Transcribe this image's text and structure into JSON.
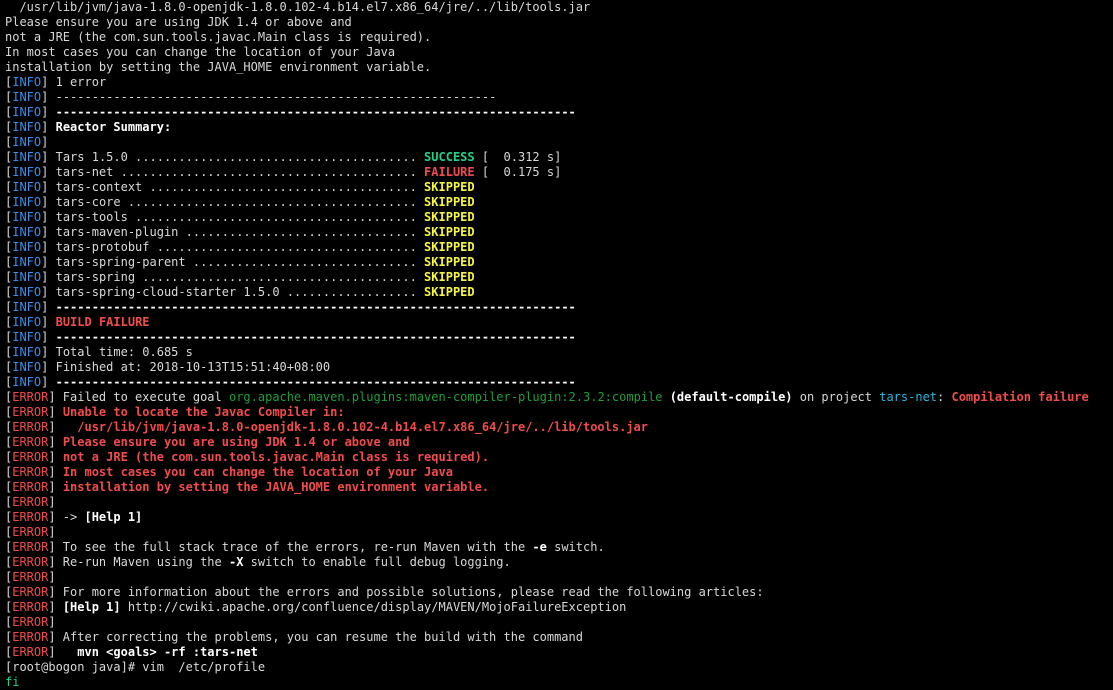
{
  "colors": {
    "background": "#000000",
    "default_text": "#d8d8d8",
    "info_tag": "#3b8eea",
    "error_tag": "#f14c4c",
    "success": "#23d18b",
    "skipped": "#f5f543",
    "plugin": "#1e9e3c",
    "project": "#29b8db"
  },
  "lines": [
    [
      {
        "t": "  /usr/lib/jvm/java-1.8.0-openjdk-1.8.0.102-4.b14.el7.x86_64/jre/../lib/tools.jar",
        "c": "default"
      }
    ],
    [
      {
        "t": "Please ensure you are using JDK 1.4 or above and",
        "c": "default"
      }
    ],
    [
      {
        "t": "not a JRE (the com.sun.tools.javac.Main class is required).",
        "c": "default"
      }
    ],
    [
      {
        "t": "In most cases you can change the location of your Java",
        "c": "default"
      }
    ],
    [
      {
        "t": "installation by setting the JAVA_HOME environment variable.",
        "c": "default"
      }
    ],
    [
      {
        "t": "[",
        "c": "default"
      },
      {
        "t": "INFO",
        "c": "blue"
      },
      {
        "t": "] 1 error",
        "c": "default"
      }
    ],
    [
      {
        "t": "[",
        "c": "default"
      },
      {
        "t": "INFO",
        "c": "blue"
      },
      {
        "t": "] -------------------------------------------------------------",
        "c": "default"
      }
    ],
    [
      {
        "t": "[",
        "c": "default"
      },
      {
        "t": "INFO",
        "c": "blue"
      },
      {
        "t": "] ",
        "c": "default"
      },
      {
        "t": "------------------------------------------------------------------------",
        "c": "white",
        "b": true
      }
    ],
    [
      {
        "t": "[",
        "c": "default"
      },
      {
        "t": "INFO",
        "c": "blue"
      },
      {
        "t": "] ",
        "c": "default"
      },
      {
        "t": "Reactor Summary:",
        "c": "white",
        "b": true
      }
    ],
    [
      {
        "t": "[",
        "c": "default"
      },
      {
        "t": "INFO",
        "c": "blue"
      },
      {
        "t": "]",
        "c": "default"
      }
    ],
    [
      {
        "t": "[",
        "c": "default"
      },
      {
        "t": "INFO",
        "c": "blue"
      },
      {
        "t": "] Tars 1.5.0 ....................................... ",
        "c": "default"
      },
      {
        "t": "SUCCESS",
        "c": "green",
        "b": true
      },
      {
        "t": " [  0.312 s]",
        "c": "default"
      }
    ],
    [
      {
        "t": "[",
        "c": "default"
      },
      {
        "t": "INFO",
        "c": "blue"
      },
      {
        "t": "] tars-net ......................................... ",
        "c": "default"
      },
      {
        "t": "FAILURE",
        "c": "red",
        "b": true
      },
      {
        "t": " [  0.175 s]",
        "c": "default"
      }
    ],
    [
      {
        "t": "[",
        "c": "default"
      },
      {
        "t": "INFO",
        "c": "blue"
      },
      {
        "t": "] tars-context ..................................... ",
        "c": "default"
      },
      {
        "t": "SKIPPED",
        "c": "yellow",
        "b": true
      }
    ],
    [
      {
        "t": "[",
        "c": "default"
      },
      {
        "t": "INFO",
        "c": "blue"
      },
      {
        "t": "] tars-core ........................................ ",
        "c": "default"
      },
      {
        "t": "SKIPPED",
        "c": "yellow",
        "b": true
      }
    ],
    [
      {
        "t": "[",
        "c": "default"
      },
      {
        "t": "INFO",
        "c": "blue"
      },
      {
        "t": "] tars-tools ....................................... ",
        "c": "default"
      },
      {
        "t": "SKIPPED",
        "c": "yellow",
        "b": true
      }
    ],
    [
      {
        "t": "[",
        "c": "default"
      },
      {
        "t": "INFO",
        "c": "blue"
      },
      {
        "t": "] tars-maven-plugin ................................ ",
        "c": "default"
      },
      {
        "t": "SKIPPED",
        "c": "yellow",
        "b": true
      }
    ],
    [
      {
        "t": "[",
        "c": "default"
      },
      {
        "t": "INFO",
        "c": "blue"
      },
      {
        "t": "] tars-protobuf .................................... ",
        "c": "default"
      },
      {
        "t": "SKIPPED",
        "c": "yellow",
        "b": true
      }
    ],
    [
      {
        "t": "[",
        "c": "default"
      },
      {
        "t": "INFO",
        "c": "blue"
      },
      {
        "t": "] tars-spring-parent ............................... ",
        "c": "default"
      },
      {
        "t": "SKIPPED",
        "c": "yellow",
        "b": true
      }
    ],
    [
      {
        "t": "[",
        "c": "default"
      },
      {
        "t": "INFO",
        "c": "blue"
      },
      {
        "t": "] tars-spring ...................................... ",
        "c": "default"
      },
      {
        "t": "SKIPPED",
        "c": "yellow",
        "b": true
      }
    ],
    [
      {
        "t": "[",
        "c": "default"
      },
      {
        "t": "INFO",
        "c": "blue"
      },
      {
        "t": "] tars-spring-cloud-starter 1.5.0 .................. ",
        "c": "default"
      },
      {
        "t": "SKIPPED",
        "c": "yellow",
        "b": true
      }
    ],
    [
      {
        "t": "[",
        "c": "default"
      },
      {
        "t": "INFO",
        "c": "blue"
      },
      {
        "t": "] ",
        "c": "default"
      },
      {
        "t": "------------------------------------------------------------------------",
        "c": "white",
        "b": true
      }
    ],
    [
      {
        "t": "[",
        "c": "default"
      },
      {
        "t": "INFO",
        "c": "blue"
      },
      {
        "t": "] ",
        "c": "default"
      },
      {
        "t": "BUILD FAILURE",
        "c": "red",
        "b": true
      }
    ],
    [
      {
        "t": "[",
        "c": "default"
      },
      {
        "t": "INFO",
        "c": "blue"
      },
      {
        "t": "] ",
        "c": "default"
      },
      {
        "t": "------------------------------------------------------------------------",
        "c": "white",
        "b": true
      }
    ],
    [
      {
        "t": "[",
        "c": "default"
      },
      {
        "t": "INFO",
        "c": "blue"
      },
      {
        "t": "] Total time: 0.685 s",
        "c": "default"
      }
    ],
    [
      {
        "t": "[",
        "c": "default"
      },
      {
        "t": "INFO",
        "c": "blue"
      },
      {
        "t": "] Finished at: 2018-10-13T15:51:40+08:00",
        "c": "default"
      }
    ],
    [
      {
        "t": "[",
        "c": "default"
      },
      {
        "t": "INFO",
        "c": "blue"
      },
      {
        "t": "] ",
        "c": "default"
      },
      {
        "t": "------------------------------------------------------------------------",
        "c": "white",
        "b": true
      }
    ],
    [
      {
        "t": "[",
        "c": "default"
      },
      {
        "t": "ERROR",
        "c": "red"
      },
      {
        "t": "] Failed to execute goal ",
        "c": "default"
      },
      {
        "t": "org.apache.maven.plugins:maven-compiler-plugin:2.3.2:compile",
        "c": "dimgreen"
      },
      {
        "t": " ",
        "c": "default"
      },
      {
        "t": "(default-compile)",
        "c": "white",
        "b": true
      },
      {
        "t": " on project ",
        "c": "default"
      },
      {
        "t": "tars-net",
        "c": "cyan"
      },
      {
        "t": ": ",
        "c": "default"
      },
      {
        "t": "Compilation failure",
        "c": "red",
        "b": true
      }
    ],
    [
      {
        "t": "[",
        "c": "default"
      },
      {
        "t": "ERROR",
        "c": "red"
      },
      {
        "t": "] ",
        "c": "default"
      },
      {
        "t": "Unable to locate the Javac Compiler in:",
        "c": "red",
        "b": true
      }
    ],
    [
      {
        "t": "[",
        "c": "default"
      },
      {
        "t": "ERROR",
        "c": "red"
      },
      {
        "t": "] ",
        "c": "default"
      },
      {
        "t": "  /usr/lib/jvm/java-1.8.0-openjdk-1.8.0.102-4.b14.el7.x86_64/jre/../lib/tools.jar",
        "c": "red",
        "b": true
      }
    ],
    [
      {
        "t": "[",
        "c": "default"
      },
      {
        "t": "ERROR",
        "c": "red"
      },
      {
        "t": "] ",
        "c": "default"
      },
      {
        "t": "Please ensure you are using JDK 1.4 or above and",
        "c": "red",
        "b": true
      }
    ],
    [
      {
        "t": "[",
        "c": "default"
      },
      {
        "t": "ERROR",
        "c": "red"
      },
      {
        "t": "] ",
        "c": "default"
      },
      {
        "t": "not a JRE (the com.sun.tools.javac.Main class is required).",
        "c": "red",
        "b": true
      }
    ],
    [
      {
        "t": "[",
        "c": "default"
      },
      {
        "t": "ERROR",
        "c": "red"
      },
      {
        "t": "] ",
        "c": "default"
      },
      {
        "t": "In most cases you can change the location of your Java",
        "c": "red",
        "b": true
      }
    ],
    [
      {
        "t": "[",
        "c": "default"
      },
      {
        "t": "ERROR",
        "c": "red"
      },
      {
        "t": "] ",
        "c": "default"
      },
      {
        "t": "installation by setting the JAVA_HOME environment variable.",
        "c": "red",
        "b": true
      }
    ],
    [
      {
        "t": "[",
        "c": "default"
      },
      {
        "t": "ERROR",
        "c": "red"
      },
      {
        "t": "]",
        "c": "default"
      }
    ],
    [
      {
        "t": "[",
        "c": "default"
      },
      {
        "t": "ERROR",
        "c": "red"
      },
      {
        "t": "] -> ",
        "c": "default"
      },
      {
        "t": "[Help 1]",
        "c": "white",
        "b": true
      }
    ],
    [
      {
        "t": "[",
        "c": "default"
      },
      {
        "t": "ERROR",
        "c": "red"
      },
      {
        "t": "]",
        "c": "default"
      }
    ],
    [
      {
        "t": "[",
        "c": "default"
      },
      {
        "t": "ERROR",
        "c": "red"
      },
      {
        "t": "] To see the full stack trace of the errors, re-run Maven with the ",
        "c": "default"
      },
      {
        "t": "-e",
        "c": "white",
        "b": true
      },
      {
        "t": " switch.",
        "c": "default"
      }
    ],
    [
      {
        "t": "[",
        "c": "default"
      },
      {
        "t": "ERROR",
        "c": "red"
      },
      {
        "t": "] Re-run Maven using the ",
        "c": "default"
      },
      {
        "t": "-X",
        "c": "white",
        "b": true
      },
      {
        "t": " switch to enable full debug logging.",
        "c": "default"
      }
    ],
    [
      {
        "t": "[",
        "c": "default"
      },
      {
        "t": "ERROR",
        "c": "red"
      },
      {
        "t": "]",
        "c": "default"
      }
    ],
    [
      {
        "t": "[",
        "c": "default"
      },
      {
        "t": "ERROR",
        "c": "red"
      },
      {
        "t": "] For more information about the errors and possible solutions, please read the following articles:",
        "c": "default"
      }
    ],
    [
      {
        "t": "[",
        "c": "default"
      },
      {
        "t": "ERROR",
        "c": "red"
      },
      {
        "t": "] ",
        "c": "default"
      },
      {
        "t": "[Help 1]",
        "c": "white",
        "b": true
      },
      {
        "t": " http://cwiki.apache.org/confluence/display/MAVEN/MojoFailureException",
        "c": "default"
      }
    ],
    [
      {
        "t": "[",
        "c": "default"
      },
      {
        "t": "ERROR",
        "c": "red"
      },
      {
        "t": "]",
        "c": "default"
      }
    ],
    [
      {
        "t": "[",
        "c": "default"
      },
      {
        "t": "ERROR",
        "c": "red"
      },
      {
        "t": "] After correcting the problems, you can resume the build with the command",
        "c": "default"
      }
    ],
    [
      {
        "t": "[",
        "c": "default"
      },
      {
        "t": "ERROR",
        "c": "red"
      },
      {
        "t": "]   ",
        "c": "default"
      },
      {
        "t": "mvn <goals> -rf :tars-net",
        "c": "white",
        "b": true
      }
    ],
    [
      {
        "t": "[root@bogon java]# vim  /etc/profile",
        "c": "default"
      }
    ],
    [
      {
        "t": "fi",
        "c": "green"
      }
    ]
  ]
}
